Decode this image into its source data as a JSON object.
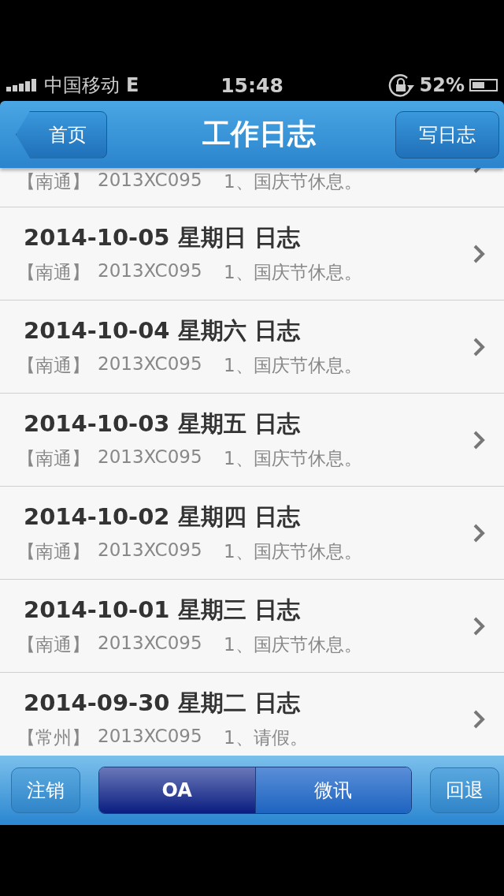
{
  "status_bar": {
    "carrier": "中国移动",
    "network": "E",
    "time": "15:48",
    "battery": "52%"
  },
  "nav": {
    "back": "首页",
    "title": "工作日志",
    "action": "写日志"
  },
  "logs": [
    {
      "partial": true,
      "city": "【南通】",
      "code": "2013XC095",
      "content": "1、国庆节休息。"
    },
    {
      "title": "2014-10-05 星期日 日志",
      "city": "【南通】",
      "code": "2013XC095",
      "content": "1、国庆节休息。"
    },
    {
      "title": "2014-10-04 星期六 日志",
      "city": "【南通】",
      "code": "2013XC095",
      "content": "1、国庆节休息。"
    },
    {
      "title": "2014-10-03 星期五 日志",
      "city": "【南通】",
      "code": "2013XC095",
      "content": "1、国庆节休息。"
    },
    {
      "title": "2014-10-02 星期四 日志",
      "city": "【南通】",
      "code": "2013XC095",
      "content": "1、国庆节休息。"
    },
    {
      "title": "2014-10-01 星期三 日志",
      "city": "【南通】",
      "code": "2013XC095",
      "content": "1、国庆节休息。"
    },
    {
      "title": "2014-09-30 星期二 日志",
      "city": "【常州】",
      "code": "2013XC095",
      "content": "1、请假。"
    }
  ],
  "toolbar": {
    "left": "注销",
    "segments": [
      {
        "label": "OA",
        "selected": true
      },
      {
        "label": "微讯",
        "selected": false
      }
    ],
    "right": "回退"
  }
}
